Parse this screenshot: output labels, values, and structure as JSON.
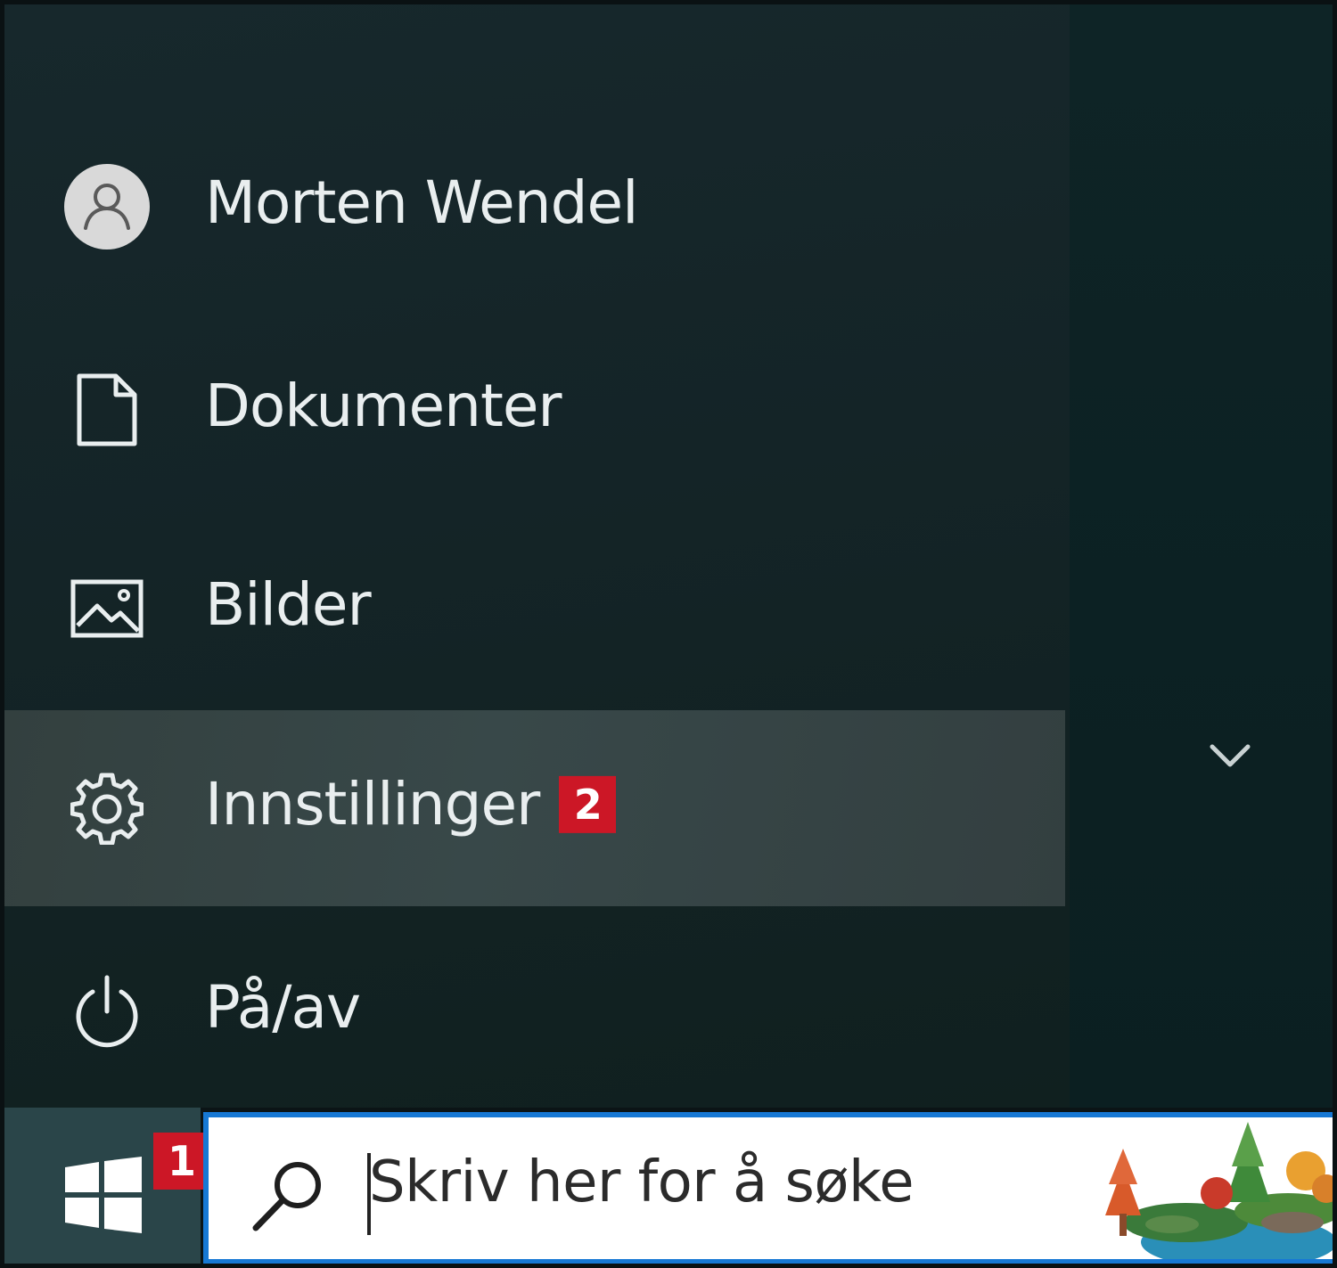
{
  "start_menu": {
    "items": [
      {
        "label": "Morten Wendel",
        "icon": "user-avatar-icon"
      },
      {
        "label": "Dokumenter",
        "icon": "document-icon"
      },
      {
        "label": "Bilder",
        "icon": "pictures-icon"
      },
      {
        "label": "Innstillinger",
        "icon": "gear-icon",
        "badge": "2",
        "highlighted": true
      },
      {
        "label": "På/av",
        "icon": "power-icon"
      }
    ],
    "expand_icon": "chevron-down-icon"
  },
  "taskbar": {
    "start_badge": "1",
    "search_placeholder": "Skriv her for å søke",
    "search_icon": "search-icon",
    "accent_color": "#1778d4"
  },
  "colors": {
    "badge": "#cc1726",
    "menu_background": "#142427",
    "highlight": "#384849"
  }
}
